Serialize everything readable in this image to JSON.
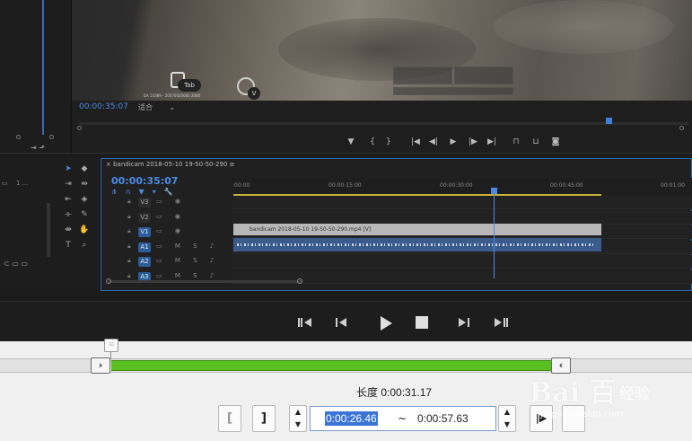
{
  "program_monitor": {
    "timecode": "00:00:35:07",
    "fit_label": "适合",
    "game_hud": {
      "tab_key": "Tab",
      "v_key": "V",
      "small_text": "DA 14389 - 20570020600 2080"
    }
  },
  "left_panel": {
    "item_label": "1 ..."
  },
  "timeline": {
    "sequence_name": "bandicam 2018-05-10 19-50-50-290",
    "timecode": "00:00:35:07",
    "ruler_labels": [
      ":00:00",
      "00:00:15:00",
      "00:00:30:00",
      "00:00:45:00",
      "00:01:00"
    ],
    "tracks": [
      {
        "name": "V3",
        "active": false,
        "icons": "▭ ◉"
      },
      {
        "name": "V2",
        "active": false,
        "icons": "▭ ◉"
      },
      {
        "name": "V1",
        "active": true,
        "icons": "▭ ◉"
      },
      {
        "name": "A1",
        "active": true,
        "icons": "▭ M S ♪"
      },
      {
        "name": "A2",
        "active": true,
        "icons": "▭ M S ♪"
      },
      {
        "name": "A3",
        "active": true,
        "icons": "▭ M S ♪"
      }
    ],
    "video_clip": "bandicam 2018-05-10 19-50-50-290.mp4 [V]"
  },
  "trim_dialog": {
    "length_label": "长度 0:00:31.17",
    "start_time": "0:00:26.46",
    "separator": "~",
    "end_time": "0:00:57.63",
    "range_start": 0.161,
    "range_end": 0.799
  },
  "watermark": {
    "logo": "Bai 百",
    "jingyan": "经验",
    "url": "jingyan.baidu.com"
  },
  "icons": {
    "player": [
      "skip-back-icon",
      "step-back-icon",
      "play-icon",
      "stop-icon",
      "step-forward-icon",
      "skip-forward-icon"
    ]
  },
  "colors": {
    "accent": "#4a8be6",
    "range_green": "#59c020",
    "selection": "#3a74d6"
  }
}
